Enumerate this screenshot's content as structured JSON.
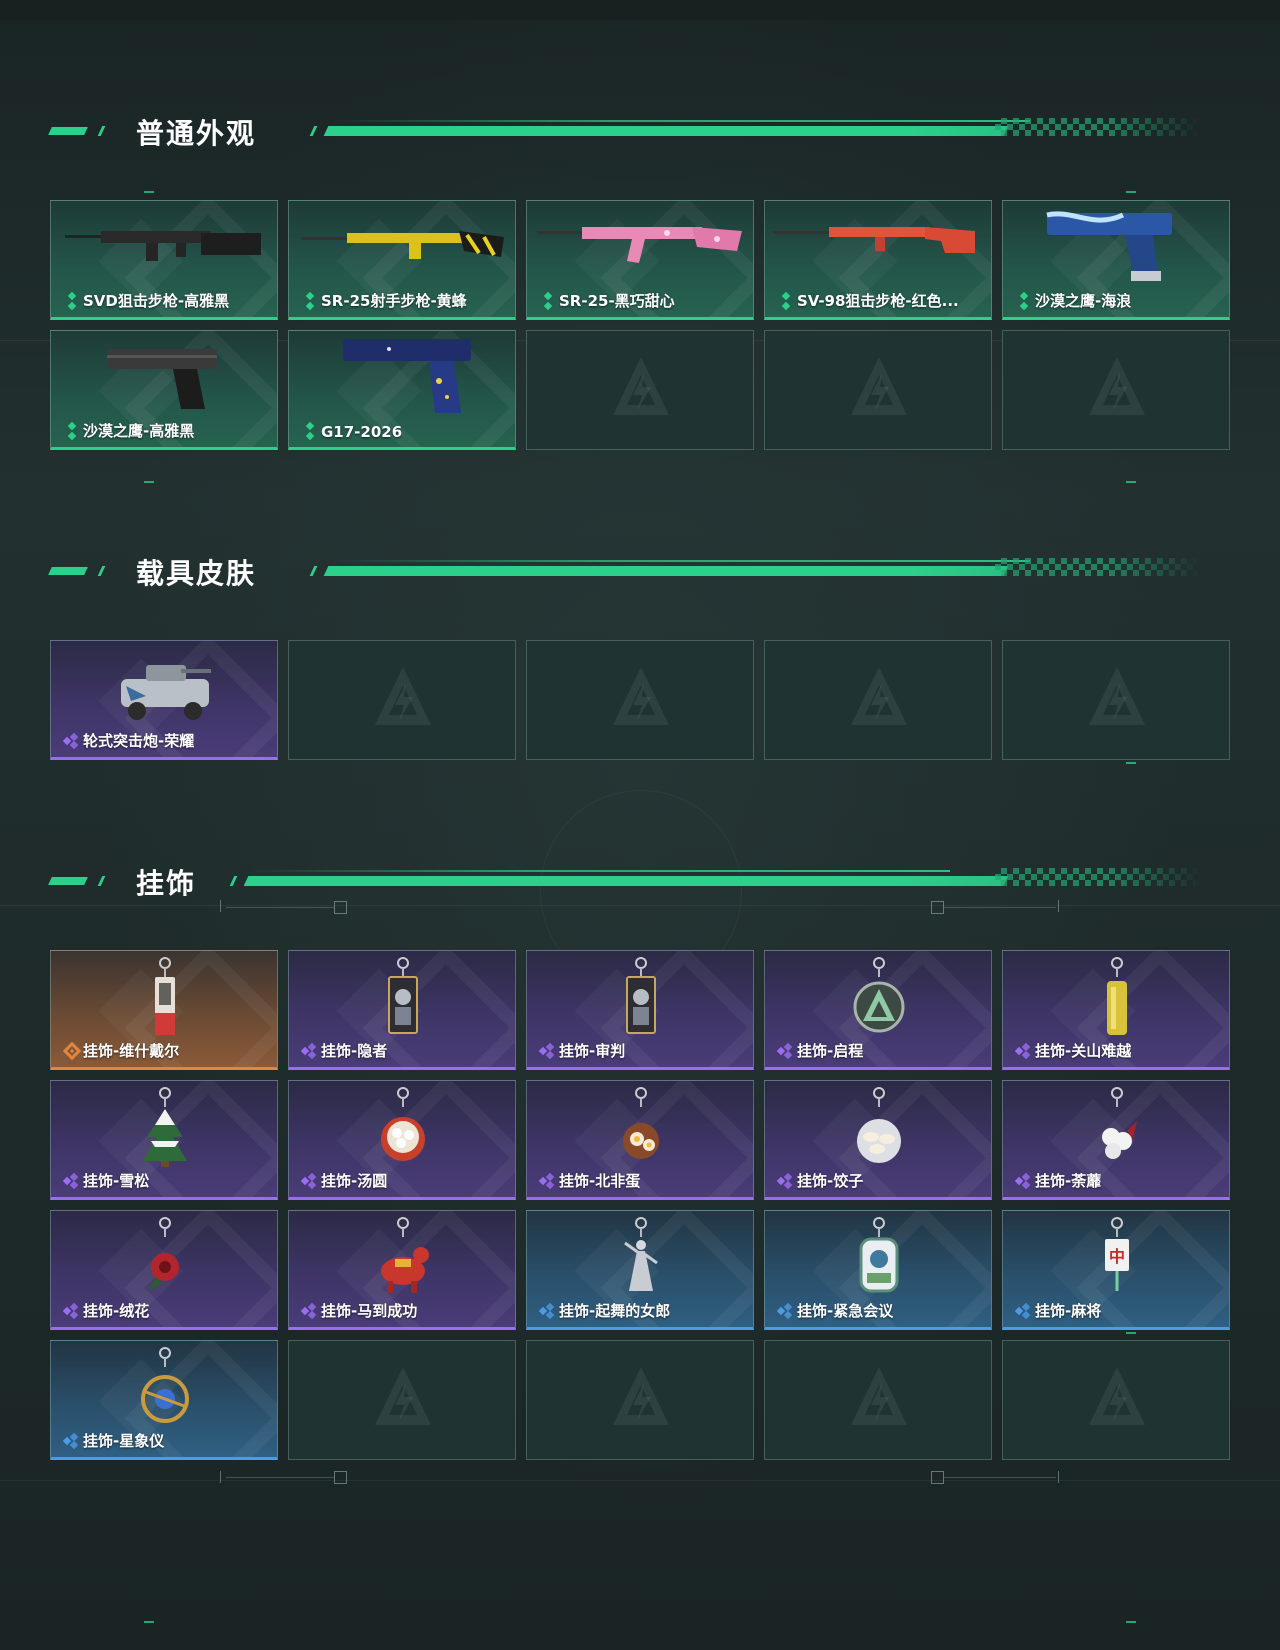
{
  "colors": {
    "accent": "#2bd18b",
    "rarity_green": "#2bd18b",
    "rarity_purple": "#9a6ef0",
    "rarity_orange": "#e0863d",
    "rarity_blue": "#4b9be6"
  },
  "sections": [
    {
      "title": "普通外观",
      "items": [
        {
          "label": "SVD狙击步枪-高雅黑",
          "rarity": "green",
          "icon": "sniper-rifle-black-icon"
        },
        {
          "label": "SR-25射手步枪-黄蜂",
          "rarity": "green",
          "icon": "marksman-rifle-yellow-icon"
        },
        {
          "label": "SR-25-黑巧甜心",
          "rarity": "green",
          "icon": "marksman-rifle-pink-icon"
        },
        {
          "label": "SV-98狙击步枪-红色...",
          "rarity": "green",
          "icon": "sniper-rifle-red-icon"
        },
        {
          "label": "沙漠之鹰-海浪",
          "rarity": "green",
          "icon": "pistol-wave-icon"
        },
        {
          "label": "沙漠之鹰-高雅黑",
          "rarity": "green",
          "icon": "pistol-black-icon"
        },
        {
          "label": "G17-2026",
          "rarity": "green",
          "icon": "pistol-blue-icon"
        }
      ]
    },
    {
      "title": "载具皮肤",
      "items": [
        {
          "label": "轮式突击炮-荣耀",
          "rarity": "purple",
          "icon": "armored-vehicle-icon"
        }
      ]
    },
    {
      "title": "挂饰",
      "items": [
        {
          "label": "挂饰-维什戴尔",
          "rarity": "orange",
          "icon": "charm-tag-icon"
        },
        {
          "label": "挂饰-隐者",
          "rarity": "purple",
          "icon": "charm-card-icon"
        },
        {
          "label": "挂饰-审判",
          "rarity": "purple",
          "icon": "charm-card-icon"
        },
        {
          "label": "挂饰-启程",
          "rarity": "purple",
          "icon": "charm-emblem-icon"
        },
        {
          "label": "挂饰-关山难越",
          "rarity": "purple",
          "icon": "charm-gold-bar-icon"
        },
        {
          "label": "挂饰-雪松",
          "rarity": "purple",
          "icon": "charm-tree-icon"
        },
        {
          "label": "挂饰-汤圆",
          "rarity": "purple",
          "icon": "charm-bowl-icon"
        },
        {
          "label": "挂饰-北非蛋",
          "rarity": "purple",
          "icon": "charm-pan-icon"
        },
        {
          "label": "挂饰-饺子",
          "rarity": "purple",
          "icon": "charm-plate-icon"
        },
        {
          "label": "挂饰-荼蘼",
          "rarity": "purple",
          "icon": "charm-flower-white-icon"
        },
        {
          "label": "挂饰-绒花",
          "rarity": "purple",
          "icon": "charm-flower-red-icon"
        },
        {
          "label": "挂饰-马到成功",
          "rarity": "purple",
          "icon": "charm-horse-icon"
        },
        {
          "label": "挂饰-起舞的女郎",
          "rarity": "blue",
          "icon": "charm-dancer-icon"
        },
        {
          "label": "挂饰-紧急会议",
          "rarity": "blue",
          "icon": "charm-badge-icon"
        },
        {
          "label": "挂饰-麻将",
          "rarity": "blue",
          "icon": "charm-mahjong-icon"
        },
        {
          "label": "挂饰-星象仪",
          "rarity": "blue",
          "icon": "charm-astrolabe-icon"
        }
      ]
    }
  ],
  "mahjong_char": "中"
}
